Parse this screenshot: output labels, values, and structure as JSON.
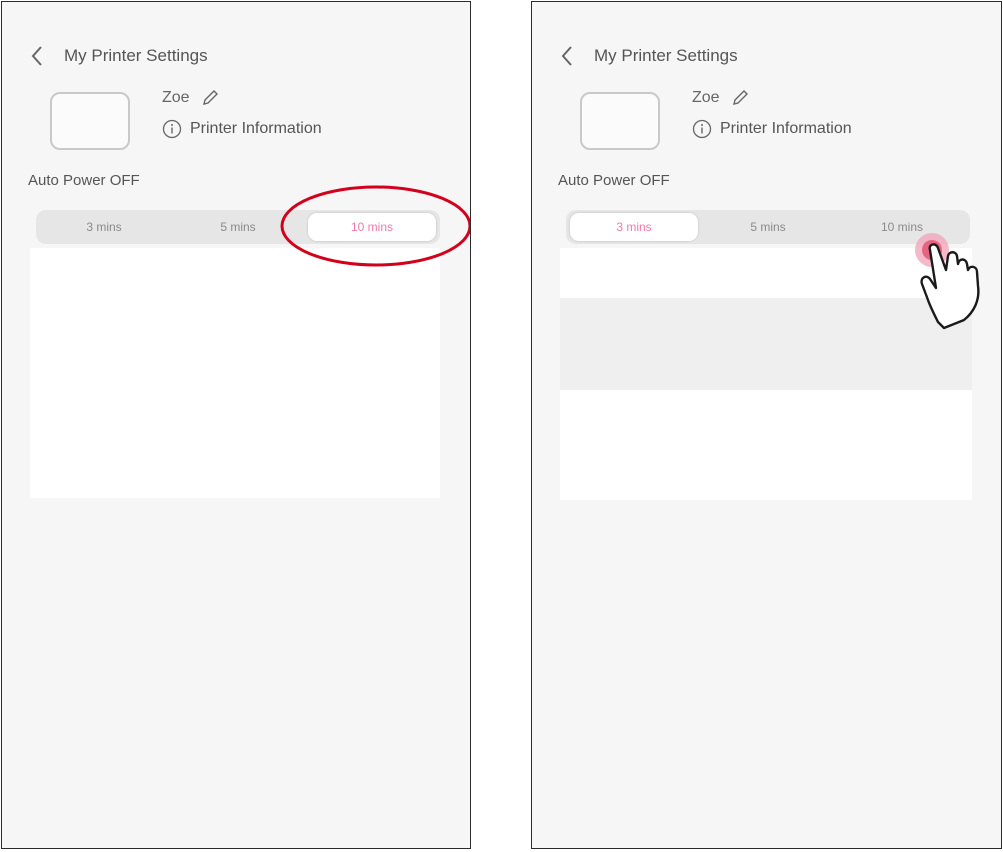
{
  "screens": [
    {
      "header": {
        "title": "My Printer Settings",
        "back_icon": "chevron-left-icon"
      },
      "printer": {
        "name": "Zoe",
        "edit_icon": "pencil-icon",
        "info_label": "Printer Information",
        "info_icon": "info-icon"
      },
      "auto_power": {
        "label": "Auto Power OFF",
        "options": [
          "3 mins",
          "5 mins",
          "10 mins"
        ],
        "selected": "10 mins"
      },
      "annotation": {
        "type": "highlight-circle",
        "color": "#d3001b",
        "target": "10 mins"
      }
    },
    {
      "header": {
        "title": "My Printer Settings",
        "back_icon": "chevron-left-icon"
      },
      "printer": {
        "name": "Zoe",
        "edit_icon": "pencil-icon",
        "info_label": "Printer Information",
        "info_icon": "info-icon"
      },
      "auto_power": {
        "label": "Auto Power OFF",
        "options": [
          "3 mins",
          "5 mins",
          "10 mins"
        ],
        "selected": "3 mins"
      },
      "annotation": {
        "type": "tap-gesture",
        "icon": "tap-hand-icon",
        "color": "#e8637f",
        "target": "10 mins"
      }
    }
  ],
  "colors": {
    "accent_pink": "#f07aa8",
    "annotation_red": "#d3001b",
    "background": "#f6f6f6"
  }
}
